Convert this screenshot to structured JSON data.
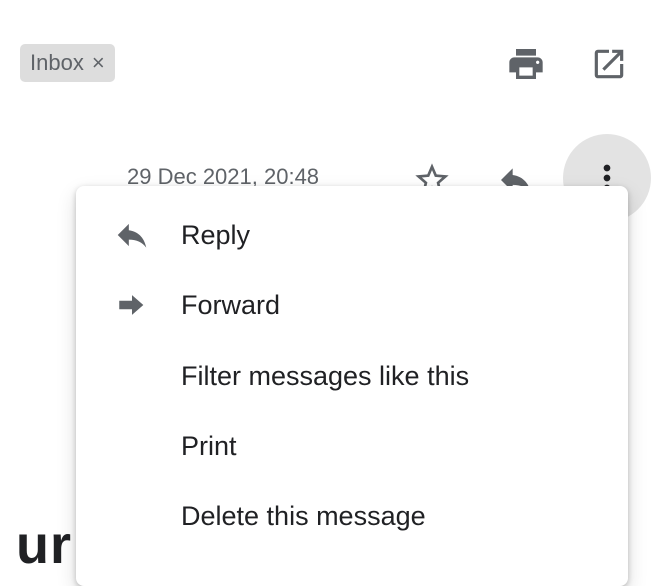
{
  "header": {
    "label_chip": {
      "text": "Inbox",
      "remove_glyph": "×"
    },
    "actions": [
      {
        "icon": "print-icon"
      },
      {
        "icon": "open-in-new-window-icon"
      }
    ]
  },
  "message": {
    "datetime": "29 Dec 2021, 20:48",
    "actions": [
      {
        "icon": "star-icon"
      },
      {
        "icon": "reply-icon"
      },
      {
        "icon": "more-vertical-icon"
      }
    ],
    "body_fragment": "ur"
  },
  "menu": {
    "items": [
      {
        "label": "Reply",
        "icon": "reply-icon"
      },
      {
        "label": "Forward",
        "icon": "forward-icon"
      },
      {
        "label": "Filter messages like this",
        "icon": ""
      },
      {
        "label": "Print",
        "icon": ""
      },
      {
        "label": "Delete this message",
        "icon": ""
      }
    ]
  },
  "colors": {
    "chip_bg": "#dddddd",
    "icon_grey": "#5f6368",
    "more_button_bg": "#e3e3e3",
    "menu_bg": "#ffffff"
  }
}
